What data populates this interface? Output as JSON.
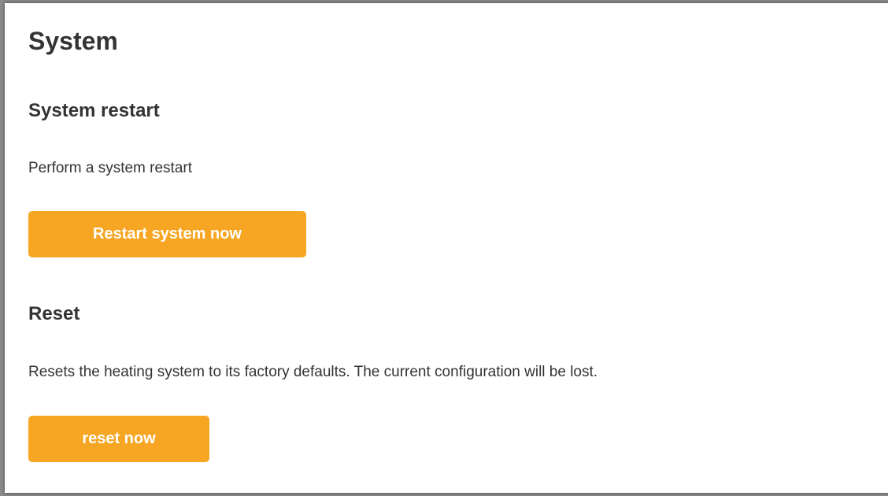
{
  "page": {
    "title": "System"
  },
  "restart": {
    "title": "System restart",
    "description": "Perform a system restart",
    "button_label": "Restart system now"
  },
  "reset": {
    "title": "Reset",
    "description": "Resets the heating system to its factory defaults. The current configuration will be lost.",
    "button_label": "reset now"
  },
  "colors": {
    "accent": "#f6a623",
    "text": "#333333",
    "background": "#ffffff"
  }
}
